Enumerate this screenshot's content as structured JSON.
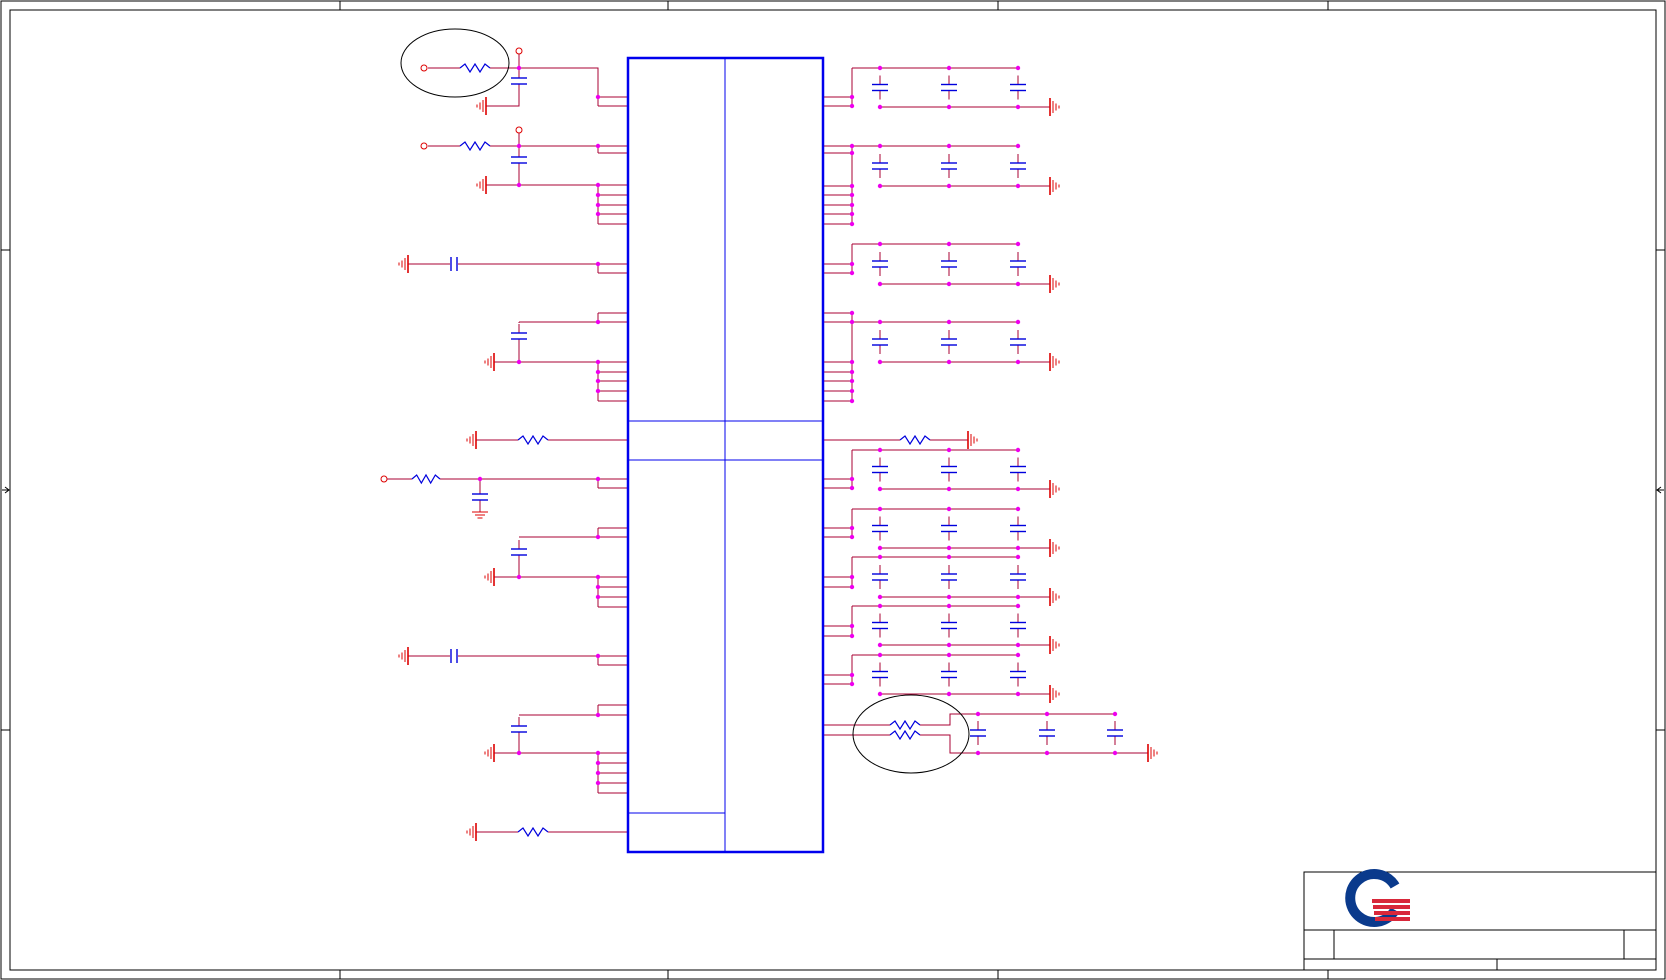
{
  "sheet": {
    "title_block": {
      "logo_icon": "company-logo-q",
      "fields": []
    },
    "colors": {
      "border": "#000000",
      "wire": "#aa0033",
      "component": "#0000dd",
      "junction": "#ee00ee",
      "ground": "#dd0000",
      "ic_outline": "#0000ee",
      "annotation": "#000000",
      "logo_blue": "#0a3a8c",
      "logo_red": "#d8283a"
    },
    "left_side": {
      "resistor_filter_inputs": 3,
      "ac_coupling_caps": 2,
      "decoupling_groups": 4,
      "ground_resistors": 2
    },
    "right_side": {
      "decoupling_banks": 10,
      "caps_per_bank": 3,
      "ground_resistor": 1,
      "highlighted_dual_resistor": true
    },
    "highlights": [
      "circle-top-left-filter",
      "circle-right-dual-resistor"
    ],
    "text_labels": []
  }
}
